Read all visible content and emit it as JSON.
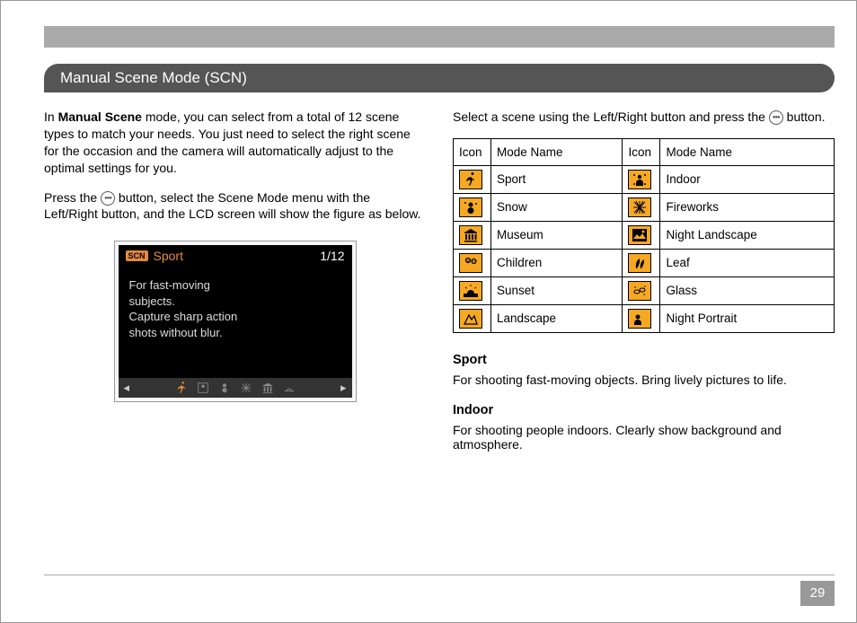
{
  "page": {
    "section_title": "Manual Scene Mode (SCN)",
    "page_number": "29"
  },
  "left": {
    "intro_pre": "In ",
    "intro_bold": "Manual Scene",
    "intro_post": " mode, you can select from a total of 12 scene types to match your needs. You just need to select the right scene for the occasion and the camera will automatically adjust to the optimal settings for you.",
    "press_pre": "Press the ",
    "press_post": " button, select the Scene Mode menu with the Left/Right button, and the LCD screen will show the figure as below."
  },
  "lcd": {
    "scn_badge": "SCN",
    "mode_name": "Sport",
    "counter": "1/12",
    "description": "For fast-moving\nsubjects.\nCapture sharp action\nshots without blur."
  },
  "right": {
    "select_pre": "Select a scene using the Left/Right button and press the ",
    "select_post": " button.",
    "table_headers": {
      "icon": "Icon",
      "mode": "Mode Name"
    },
    "rows": [
      {
        "left": "Sport",
        "right": "Indoor"
      },
      {
        "left": "Snow",
        "right": "Fireworks"
      },
      {
        "left": "Museum",
        "right": "Night Landscape"
      },
      {
        "left": "Children",
        "right": "Leaf"
      },
      {
        "left": "Sunset",
        "right": "Glass"
      },
      {
        "left": "Landscape",
        "right": "Night Portrait"
      }
    ],
    "sport": {
      "title": "Sport",
      "desc": "For shooting fast-moving objects. Bring lively pictures to life."
    },
    "indoor": {
      "title": "Indoor",
      "desc": "For shooting people indoors. Clearly show background and atmosphere."
    }
  }
}
